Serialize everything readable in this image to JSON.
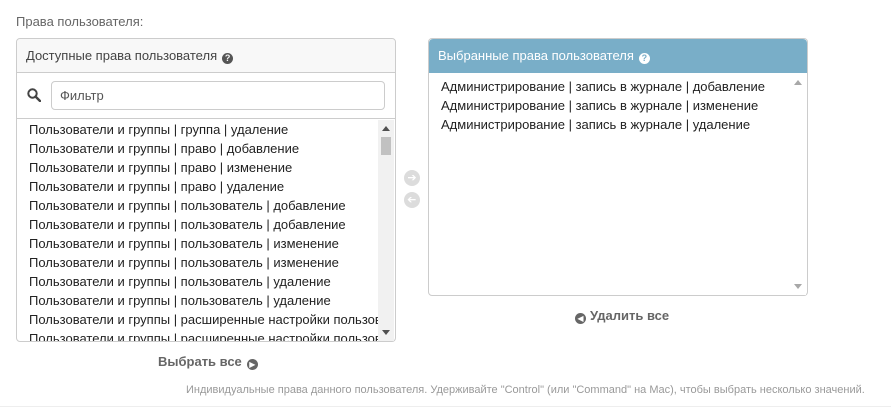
{
  "field_label": "Права пользователя:",
  "available": {
    "title": "Доступные права пользователя",
    "filter_placeholder": "Фильтр",
    "items": [
      "Пользователи и группы | группа | удаление",
      "Пользователи и группы | право | добавление",
      "Пользователи и группы | право | изменение",
      "Пользователи и группы | право | удаление",
      "Пользователи и группы | пользователь | добавление",
      "Пользователи и группы | пользователь | добавление",
      "Пользователи и группы | пользователь | изменение",
      "Пользователи и группы | пользователь | изменение",
      "Пользователи и группы | пользователь | удаление",
      "Пользователи и группы | пользователь | удаление",
      "Пользователи и группы | расширенные настройки пользователя",
      "Пользователи и группы | расширенные настройки пользователя"
    ]
  },
  "chosen": {
    "title": "Выбранные права пользователя",
    "items": [
      "Администрирование | запись в журнале | добавление",
      "Администрирование | запись в журнале | изменение",
      "Администрирование | запись в журнале | удаление"
    ]
  },
  "actions": {
    "choose_all": "Выбрать все",
    "clear_all": "Удалить все"
  },
  "help_text": "Индивидуальные права данного пользователя. Удерживайте \"Control\" (или \"Command\" на Mac), чтобы выбрать несколько значений.",
  "icons": {
    "help": "question-circle-icon",
    "search": "search-icon",
    "add": "arrow-right-circle-icon",
    "remove": "arrow-left-circle-icon"
  },
  "colors": {
    "chosen_header": "#79aec8",
    "text": "#333333",
    "muted": "#999999"
  }
}
